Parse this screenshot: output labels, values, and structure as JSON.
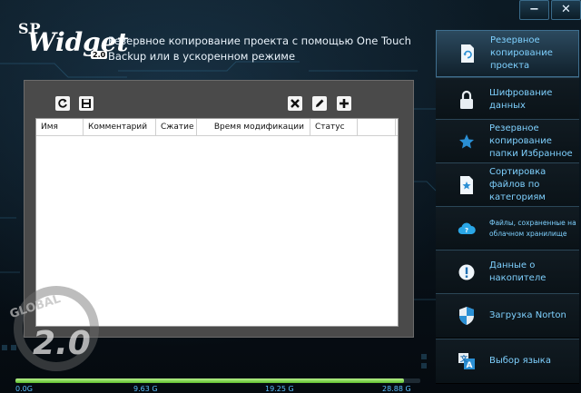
{
  "window": {
    "minimize_label": "−",
    "close_label": "✕"
  },
  "logo": {
    "brand": "SP",
    "product": "Widget",
    "version": "2.0"
  },
  "header": {
    "description": "Резервное копирование проекта с помощью One Touch Backup или в ускоренном режиме"
  },
  "toolbar": {
    "left_icons": [
      "refresh-icon",
      "save-icon"
    ],
    "right_icons": [
      "delete-icon",
      "edit-icon",
      "add-icon"
    ]
  },
  "table": {
    "columns": [
      "Имя",
      "Комментарий",
      "Сжатие",
      "Время модификации",
      "Статус",
      ""
    ],
    "rows": []
  },
  "watermark": {
    "text": "GLOBAL 2.0"
  },
  "storage": {
    "scale": [
      "0.0G",
      "9.63 G",
      "19.25 G",
      "28.88 G"
    ],
    "used_fraction": 0.96,
    "bar_color": "#7ed957"
  },
  "sidebar": {
    "items": [
      {
        "label": "Резервное копирование проекта",
        "icon": "backup-doc-icon",
        "active": true
      },
      {
        "label": "Шифрование данных",
        "icon": "lock-icon",
        "active": false
      },
      {
        "label": "Резервное копирование папки Избранное",
        "icon": "star-icon",
        "active": false
      },
      {
        "label": "Сортировка файлов по категориям",
        "icon": "star-doc-icon",
        "active": false
      },
      {
        "label": "Файлы, сохраненные на облачном хранилище",
        "icon": "cloud-icon",
        "active": false
      },
      {
        "label": "Данные о накопителе",
        "icon": "info-icon",
        "active": false
      },
      {
        "label": "Загрузка  Norton",
        "icon": "shield-icon",
        "active": false
      },
      {
        "label": "Выбор языка",
        "icon": "language-icon",
        "active": false
      }
    ]
  },
  "colors": {
    "accent": "#7fd1ff",
    "background": "#0a1218",
    "panel": "#4a4a4a"
  }
}
